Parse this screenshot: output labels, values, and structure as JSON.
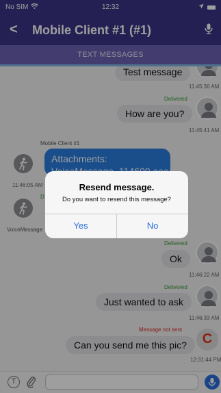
{
  "status_bar": {
    "carrier": "No SIM",
    "time": "12:32"
  },
  "nav": {
    "back_label": "<",
    "title": "Mobile Client #1 (#1)"
  },
  "section": {
    "label": "TEXT MESSAGES"
  },
  "messages": [
    {
      "text": "Test message",
      "time": "11:45:36 AM",
      "status": ""
    },
    {
      "text": "How are you?",
      "time": "11:45:41 AM",
      "status": "Delivered"
    },
    {
      "sender": "Mobile Client #1",
      "text": "Attachments:\nVoiceMessage_114600.aac",
      "time": "11:46:05 AM"
    },
    {
      "sender": "VoiceMessage",
      "status": "D"
    },
    {
      "text": "Ok",
      "time": "11:46:22 AM",
      "status": "Delivered"
    },
    {
      "text": "Just wanted to ask",
      "time": "11:46:33 AM",
      "status": "Delivered"
    },
    {
      "text": "Can you send me this pic?",
      "time": "12:31:44 PM",
      "status": "Message not sent",
      "retry_label": "C"
    }
  ],
  "alert": {
    "title": "Resend message.",
    "message": "Do you want to resend this message?",
    "yes_label": "Yes",
    "no_label": "No"
  },
  "input": {
    "format_label": "T",
    "placeholder": ""
  },
  "colors": {
    "nav_bg": "#3b3486",
    "section_bg": "#6b62b3",
    "accent": "#2a6fdb",
    "error": "#d93025",
    "delivered": "#3a9a3a"
  }
}
